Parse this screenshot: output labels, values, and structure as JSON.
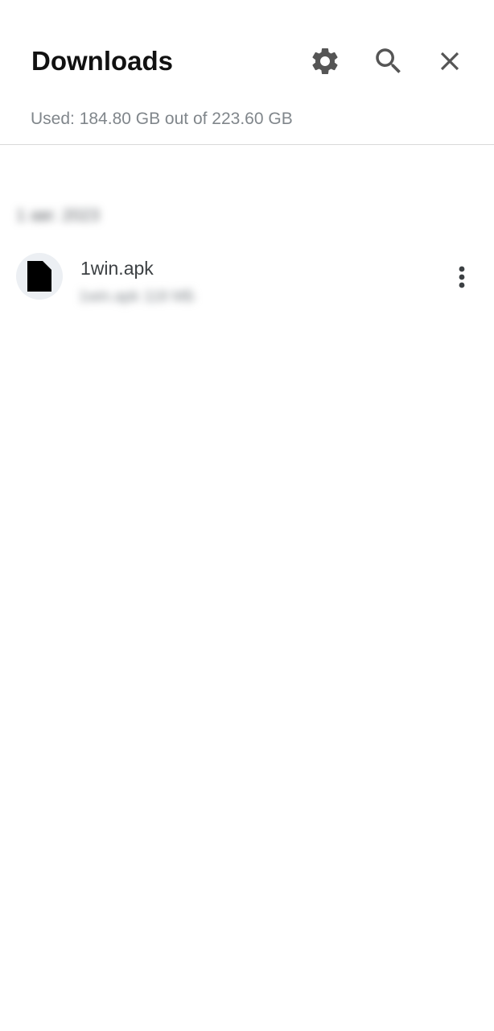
{
  "header": {
    "title": "Downloads",
    "icons": {
      "settings": "gear-icon",
      "search": "search-icon",
      "close": "close-icon"
    },
    "icon_color": "#555555"
  },
  "storage": {
    "used_text": "Used: 184.80 GB out of 223.60 GB"
  },
  "sections": [
    {
      "date_label": "1 авг. 2023",
      "items": [
        {
          "name": "1win.apk",
          "meta": "1win.apk  118 МБ",
          "icon": "file-icon",
          "menu_icon": "more-vert-icon"
        }
      ]
    }
  ]
}
